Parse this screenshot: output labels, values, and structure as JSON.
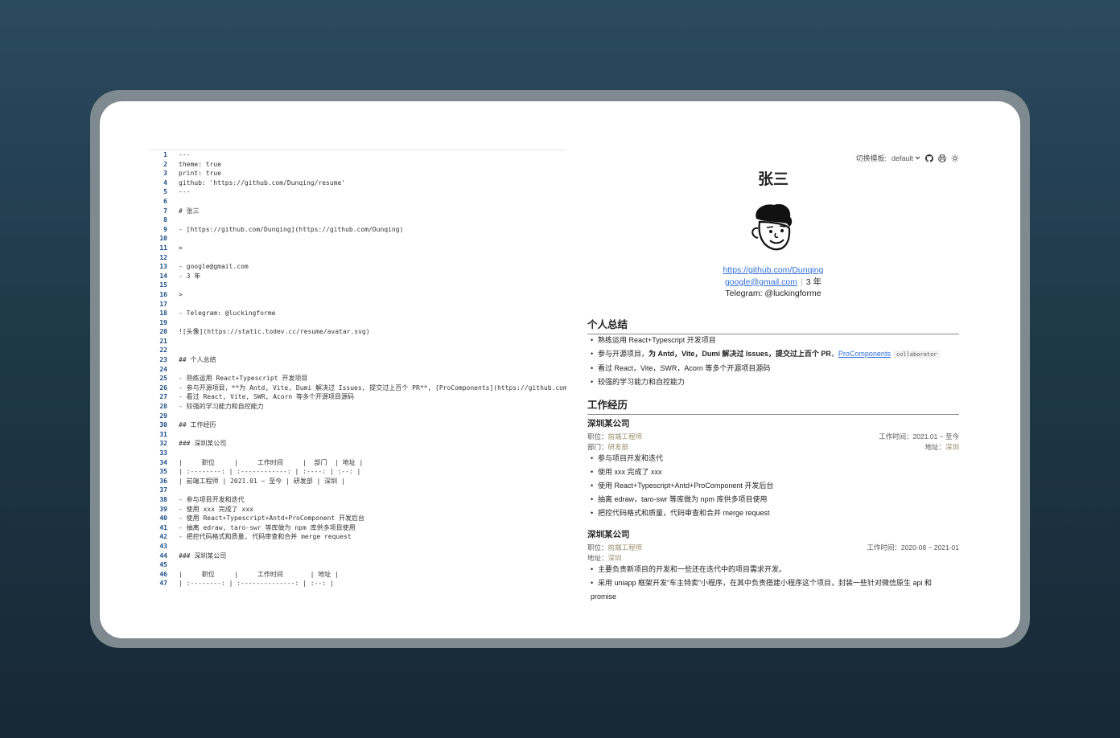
{
  "editor": {
    "lines": [
      "---",
      "theme: true",
      "print: true",
      "github: 'https://github.com/Dunqing/resume'",
      "---",
      "",
      "# 张三",
      "",
      "- [https://github.com/Dunqing](https://github.com/Dunqing)",
      "",
      ">",
      "",
      "- google@gmail.com",
      "- 3 年",
      "",
      ">",
      "",
      "- Telegram: @luckingforme",
      "",
      "![头像](https://static.todev.cc/resume/avatar.svg)",
      "",
      "",
      "## 个人总结",
      "",
      "- 熟练运用 React+Typescript 开发项目",
      "- 参与开源项目，**为 Antd, Vite, Dumi 解决过 Issues, 提交过上百个 PR**, [ProComponents](https://github.com",
      "- 看过 React, Vite, SWR, Acorn 等多个开源项目源码",
      "- 较强的学习能力和自控能力",
      "",
      "## 工作经历",
      "",
      "### 深圳某公司",
      "",
      "|     职位     |     工作时间     |  部门  | 地址 |",
      "| :--------: | :------------: | :----: | :--: |",
      "| 前端工程师 | 2021.01 ~ 至今 | 研发部 | 深圳 |",
      "",
      "- 参与项目开发和迭代",
      "- 使用 xxx 完成了 xxx",
      "- 使用 React+Typescript+Antd+ProComponent 开发后台",
      "- 抽离 edraw, taro-swr 等库做为 npm 库供多项目使用",
      "- 把控代码格式和质量, 代码审查和合并 merge request",
      "",
      "### 深圳某公司",
      "",
      "|     职位     |     工作时间       | 地址 |",
      "| :--------: | :--------------: | :--: |"
    ]
  },
  "preview": {
    "toolbar": {
      "switch_label": "切换模板:",
      "template_value": "default"
    },
    "name": "张三",
    "contacts": {
      "github": "https://github.com/Dunqing",
      "email": "google@gmail.com",
      "years": "3 年",
      "telegram": "Telegram: @luckingforme"
    },
    "summary": {
      "heading": "个人总结",
      "item1": "熟练运用 React+Typescript 开发项目",
      "item2_pre": "参与开源项目，",
      "item2_bold": "为 Antd，Vite，Dumi 解决过 Issues，提交过上百个 PR",
      "item2_mid": "，",
      "item2_link": "ProComponents",
      "item2_tag": "collaborator",
      "item3": "看过 React，Vite，SWR，Acorn 等多个开源项目源码",
      "item4": "较强的学习能力和自控能力"
    },
    "work": {
      "heading": "工作经历",
      "job1": {
        "company": "深圳某公司",
        "role_label": "职位：",
        "role": "前端工程师",
        "time_label": "工作时间：",
        "time": "2021.01 ~ 至今",
        "dept_label": "部门：",
        "dept": "研发部",
        "addr_label": "地址：",
        "addr": "深圳",
        "items": [
          "参与项目开发和迭代",
          "使用 xxx 完成了 xxx",
          "使用 React+Typescript+Antd+ProComponent 开发后台",
          "抽离 edraw，taro-swr 等库做为 npm 库供多项目使用",
          "把控代码格式和质量，代码审查和合并 merge request"
        ]
      },
      "job2": {
        "company": "深圳某公司",
        "role_label": "职位：",
        "role": "前端工程师",
        "time_label": "工作时间：",
        "time": "2020-08 ~ 2021-01",
        "addr_label": "地址：",
        "addr": "深圳",
        "items": [
          "主要负责新项目的开发和一些还在迭代中的项目需求开发。",
          "采用 uniapp 框架开发“车主特卖”小程序，在其中负责搭建小程序这个项目，封装一些针对微信原生 api 和 promise"
        ]
      }
    },
    "icons": [
      "chevron-down-icon",
      "github-icon",
      "printer-icon",
      "sun-icon"
    ]
  }
}
